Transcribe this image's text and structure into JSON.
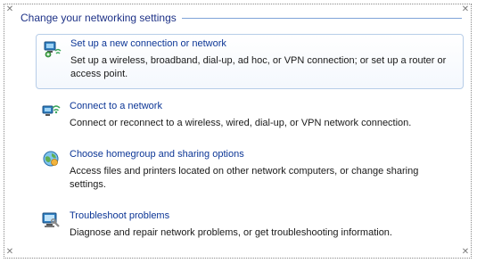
{
  "section": {
    "title": "Change your networking settings"
  },
  "items": [
    {
      "icon": "new-connection-icon",
      "title": "Set up a new connection or network",
      "description": "Set up a wireless, broadband, dial-up, ad hoc, or VPN connection; or set up a router or access point.",
      "selected": true
    },
    {
      "icon": "connect-network-icon",
      "title": "Connect to a network",
      "description": "Connect or reconnect to a wireless, wired, dial-up, or VPN network connection.",
      "selected": false
    },
    {
      "icon": "homegroup-icon",
      "title": "Choose homegroup and sharing options",
      "description": "Access files and printers located on other network computers, or change sharing settings.",
      "selected": false
    },
    {
      "icon": "troubleshoot-icon",
      "title": "Troubleshoot problems",
      "description": "Diagnose and repair network problems, or get troubleshooting information.",
      "selected": false
    }
  ],
  "colors": {
    "link": "#0c3696",
    "header": "#1e3287",
    "selection_border": "#b7cde8"
  }
}
